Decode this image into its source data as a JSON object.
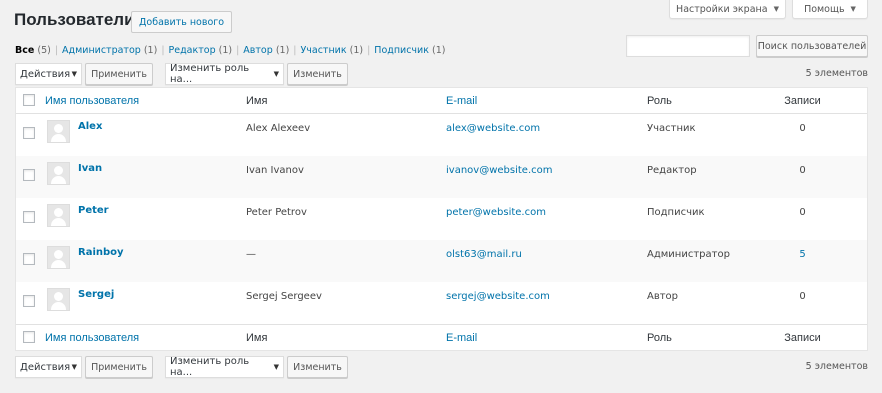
{
  "header": {
    "screen_options_label": "Настройки экрана",
    "help_label": "Помощь",
    "title": "Пользователи",
    "add_new_label": "Добавить нового"
  },
  "filters": [
    {
      "label": "Все",
      "count": "(5)",
      "current": true
    },
    {
      "label": "Администратор",
      "count": "(1)"
    },
    {
      "label": "Редактор",
      "count": "(1)"
    },
    {
      "label": "Автор",
      "count": "(1)"
    },
    {
      "label": "Участник",
      "count": "(1)"
    },
    {
      "label": "Подписчик",
      "count": "(1)"
    }
  ],
  "search": {
    "value": "",
    "button_label": "Поиск пользователей"
  },
  "tablenav": {
    "bulk_action": "Действия",
    "apply_label": "Применить",
    "change_role": "Изменить роль на...",
    "change_label": "Изменить",
    "count": "5 элементов"
  },
  "table": {
    "columns": {
      "username": "Имя пользователя",
      "name": "Имя",
      "email": "E-mail",
      "role": "Роль",
      "posts": "Записи"
    },
    "rows": [
      {
        "username": "Alex",
        "name": "Alex Alexeev",
        "email": "alex@website.com",
        "role": "Участник",
        "posts": "0"
      },
      {
        "username": "Ivan",
        "name": "Ivan Ivanov",
        "email": "ivanov@website.com",
        "role": "Редактор",
        "posts": "0"
      },
      {
        "username": "Peter",
        "name": "Peter Petrov",
        "email": "peter@website.com",
        "role": "Подписчик",
        "posts": "0"
      },
      {
        "username": "Rainboy",
        "name": "—",
        "email": "olst63@mail.ru",
        "role": "Администратор",
        "posts": "5"
      },
      {
        "username": "Sergej",
        "name": "Sergej Sergeev",
        "email": "sergej@website.com",
        "role": "Автор",
        "posts": "0"
      }
    ]
  },
  "colors": {
    "link": "#0073aa",
    "background": "#f1f1f1"
  },
  "icons": {
    "dropdown": "caret-down-icon",
    "avatar": "default-avatar-icon"
  }
}
